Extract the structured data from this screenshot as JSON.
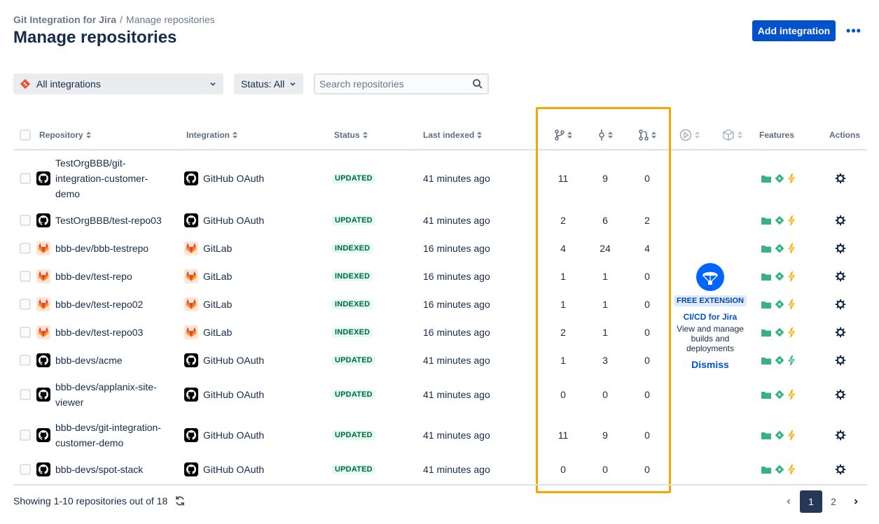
{
  "breadcrumb": {
    "app": "Git Integration for Jira",
    "separator": "/",
    "current": "Manage repositories"
  },
  "page_title": "Manage repositories",
  "header": {
    "add_button": "Add integration",
    "more_button": "•••"
  },
  "filters": {
    "integration": "All integrations",
    "status": "Status: All",
    "search_placeholder": "Search repositories"
  },
  "columns": {
    "repository": "Repository",
    "integration": "Integration",
    "status": "Status",
    "last_indexed": "Last indexed",
    "features": "Features",
    "actions": "Actions"
  },
  "rows": [
    {
      "repo": "TestOrgBBB/git-integration-customer-demo",
      "type": "github",
      "integration": "GitHub OAuth",
      "status": "UPDATED",
      "last": "41 minutes ago",
      "branches": "11",
      "commits": "9",
      "prs": "0",
      "build": "yellow"
    },
    {
      "repo": "TestOrgBBB/test-repo03",
      "type": "github",
      "integration": "GitHub OAuth",
      "status": "UPDATED",
      "last": "41 minutes ago",
      "branches": "2",
      "commits": "6",
      "prs": "2",
      "build": "yellow"
    },
    {
      "repo": "bbb-dev/bbb-testrepo",
      "type": "gitlab",
      "integration": "GitLab",
      "status": "INDEXED",
      "last": "16 minutes ago",
      "branches": "4",
      "commits": "24",
      "prs": "4",
      "build": "yellow"
    },
    {
      "repo": "bbb-dev/test-repo",
      "type": "gitlab",
      "integration": "GitLab",
      "status": "INDEXED",
      "last": "16 minutes ago",
      "branches": "1",
      "commits": "1",
      "prs": "0",
      "build": "yellow"
    },
    {
      "repo": "bbb-dev/test-repo02",
      "type": "gitlab",
      "integration": "GitLab",
      "status": "INDEXED",
      "last": "16 minutes ago",
      "branches": "1",
      "commits": "1",
      "prs": "0",
      "build": "yellow"
    },
    {
      "repo": "bbb-dev/test-repo03",
      "type": "gitlab",
      "integration": "GitLab",
      "status": "INDEXED",
      "last": "16 minutes ago",
      "branches": "2",
      "commits": "1",
      "prs": "0",
      "build": "yellow"
    },
    {
      "repo": "bbb-devs/acme",
      "type": "github",
      "integration": "GitHub OAuth",
      "status": "UPDATED",
      "last": "41 minutes ago",
      "branches": "1",
      "commits": "3",
      "prs": "0",
      "build": "green"
    },
    {
      "repo": "bbb-devs/applanix-site-viewer",
      "type": "github",
      "integration": "GitHub OAuth",
      "status": "UPDATED",
      "last": "41 minutes ago",
      "branches": "0",
      "commits": "0",
      "prs": "0",
      "build": "yellow"
    },
    {
      "repo": "bbb-devs/git-integration-customer-demo",
      "type": "github",
      "integration": "GitHub OAuth",
      "status": "UPDATED",
      "last": "41 minutes ago",
      "branches": "11",
      "commits": "9",
      "prs": "0",
      "build": "yellow"
    },
    {
      "repo": "bbb-devs/spot-stack",
      "type": "github",
      "integration": "GitHub OAuth",
      "status": "UPDATED",
      "last": "41 minutes ago",
      "branches": "0",
      "commits": "0",
      "prs": "0",
      "build": "yellow"
    }
  ],
  "promo": {
    "badge": "FREE EXTENSION",
    "title": "CI/CD for Jira",
    "description": "View and manage builds and deployments",
    "dismiss": "Dismiss"
  },
  "footer": {
    "showing": "Showing 1-10 repositories out of 18",
    "pages": [
      "1",
      "2"
    ],
    "current_page": "1"
  },
  "colors": {
    "primary": "#0052cc",
    "highlight": "#f5a700",
    "folder": "#36b37e",
    "bolt_yellow": "#ffab00",
    "bolt_green": "#36b37e"
  }
}
